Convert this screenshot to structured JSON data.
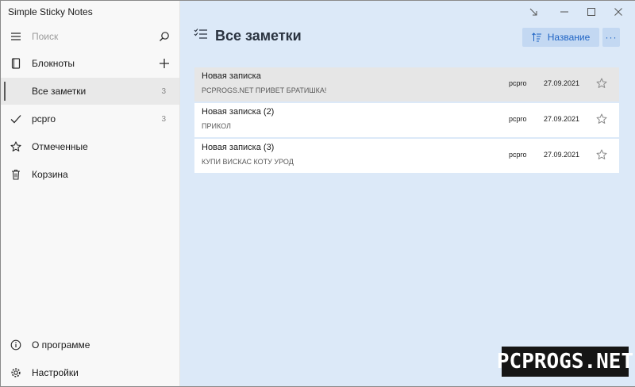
{
  "app": {
    "title": "Simple Sticky Notes"
  },
  "sidebar": {
    "search_placeholder": "Поиск",
    "notebooks_label": "Блокноты",
    "items": [
      {
        "label": "Все заметки",
        "count": "3",
        "icon": "none"
      },
      {
        "label": "pcpro",
        "count": "3",
        "icon": "checkmark-icon"
      },
      {
        "label": "Отмеченные",
        "icon": "star-icon"
      },
      {
        "label": "Корзина",
        "icon": "trash-icon"
      }
    ],
    "footer": [
      {
        "label": "О программе",
        "icon": "info-icon"
      },
      {
        "label": "Настройки",
        "icon": "gear-icon"
      }
    ]
  },
  "main": {
    "title": "Все заметки",
    "sort_label": "Название",
    "more_label": "···",
    "notes": [
      {
        "title": "Новая записка",
        "preview": "PCPROGS.NET ПРИВЕТ БРАТИШКА!",
        "notebook": "pcpro",
        "date": "27.09.2021"
      },
      {
        "title": "Новая записка (2)",
        "preview": "ПРИКОЛ",
        "notebook": "pcpro",
        "date": "27.09.2021"
      },
      {
        "title": "Новая записка (3)",
        "preview": "КУПИ ВИСКАС КОТУ УРОД",
        "notebook": "pcpro",
        "date": "27.09.2021"
      }
    ]
  },
  "watermark": "PCPROGS.NET",
  "colors": {
    "main_bg": "#dce9f8",
    "accent": "#1e63c4",
    "button_bg": "#c3d8f2",
    "sidebar_bg": "#f8f8f8",
    "row_hover": "#e6e6e6"
  }
}
